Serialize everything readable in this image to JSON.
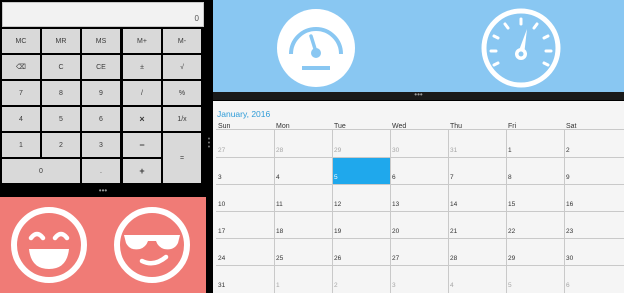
{
  "calculator": {
    "display": "0",
    "keys": [
      {
        "label": "MC"
      },
      {
        "label": "MR"
      },
      {
        "label": "MS"
      },
      {
        "label": "M+"
      },
      {
        "label": "M-"
      },
      {
        "label": "⌫"
      },
      {
        "label": "C"
      },
      {
        "label": "CE"
      },
      {
        "label": "±"
      },
      {
        "label": "√"
      },
      {
        "label": "7"
      },
      {
        "label": "8"
      },
      {
        "label": "9"
      },
      {
        "label": "/"
      },
      {
        "label": "%"
      },
      {
        "label": "4"
      },
      {
        "label": "5"
      },
      {
        "label": "6"
      },
      {
        "label": "×"
      },
      {
        "label": "1/x"
      },
      {
        "label": "1"
      },
      {
        "label": "2"
      },
      {
        "label": "3"
      },
      {
        "label": "−"
      },
      {
        "label": "="
      },
      {
        "label": "0"
      },
      {
        "label": "."
      },
      {
        "label": "+"
      }
    ]
  },
  "emoji_panel": {
    "background": "#f07b76",
    "icons": [
      "laughing-face-icon",
      "sunglasses-face-icon"
    ]
  },
  "gauge_panel": {
    "background": "#89c7f2",
    "icons": [
      "speedometer-icon",
      "dial-gauge-icon"
    ]
  },
  "calendar": {
    "title": "January, 2016",
    "weekdays": [
      "Sun",
      "Mon",
      "Tue",
      "Wed",
      "Thu",
      "Fri",
      "Sat"
    ],
    "selected_day": "5",
    "selected_color": "#1fa8ec",
    "weeks": [
      [
        {
          "d": "27",
          "o": true
        },
        {
          "d": "28",
          "o": true
        },
        {
          "d": "29",
          "o": true
        },
        {
          "d": "30",
          "o": true
        },
        {
          "d": "31",
          "o": true
        },
        {
          "d": "1",
          "o": false
        },
        {
          "d": "2",
          "o": false
        }
      ],
      [
        {
          "d": "3",
          "o": false
        },
        {
          "d": "4",
          "o": false
        },
        {
          "d": "5",
          "o": false
        },
        {
          "d": "6",
          "o": false
        },
        {
          "d": "7",
          "o": false
        },
        {
          "d": "8",
          "o": false
        },
        {
          "d": "9",
          "o": false
        }
      ],
      [
        {
          "d": "10",
          "o": false
        },
        {
          "d": "11",
          "o": false
        },
        {
          "d": "12",
          "o": false
        },
        {
          "d": "13",
          "o": false
        },
        {
          "d": "14",
          "o": false
        },
        {
          "d": "15",
          "o": false
        },
        {
          "d": "16",
          "o": false
        }
      ],
      [
        {
          "d": "17",
          "o": false
        },
        {
          "d": "18",
          "o": false
        },
        {
          "d": "19",
          "o": false
        },
        {
          "d": "20",
          "o": false
        },
        {
          "d": "21",
          "o": false
        },
        {
          "d": "22",
          "o": false
        },
        {
          "d": "23",
          "o": false
        }
      ],
      [
        {
          "d": "24",
          "o": false
        },
        {
          "d": "25",
          "o": false
        },
        {
          "d": "26",
          "o": false
        },
        {
          "d": "27",
          "o": false
        },
        {
          "d": "28",
          "o": false
        },
        {
          "d": "29",
          "o": false
        },
        {
          "d": "30",
          "o": false
        }
      ],
      [
        {
          "d": "31",
          "o": false
        },
        {
          "d": "1",
          "o": true
        },
        {
          "d": "2",
          "o": true
        },
        {
          "d": "3",
          "o": true
        },
        {
          "d": "4",
          "o": true
        },
        {
          "d": "5",
          "o": true
        },
        {
          "d": "6",
          "o": true
        }
      ]
    ]
  }
}
